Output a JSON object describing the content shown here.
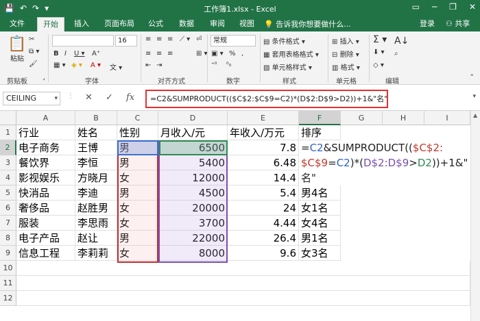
{
  "window": {
    "title": "工作簿1.xlsx - Excel",
    "qat": [
      "💾",
      "↶",
      "↷",
      "▾"
    ],
    "controls": [
      "▭",
      "─",
      "❐",
      "✕"
    ]
  },
  "tabs": [
    "文件",
    "开始",
    "插入",
    "页面布局",
    "公式",
    "数据",
    "审阅",
    "视图"
  ],
  "active_tab": "开始",
  "tellme": "告诉我你想要做什么...",
  "account": {
    "login": "登录",
    "share": "共享"
  },
  "ribbon": {
    "groups": [
      "剪贴板",
      "字体",
      "对齐方式",
      "数字",
      "样式",
      "单元格",
      "编辑"
    ],
    "paste": "粘贴",
    "font_size": "16",
    "number_format": "常规",
    "styles": [
      "条件格式 ▾",
      "套用表格格式 ▾",
      "单元格样式 ▾"
    ],
    "cells": [
      "插入 ▾",
      "删除 ▾",
      "格式 ▾"
    ]
  },
  "formula_bar": {
    "name_box": "CEILING",
    "formula": "=C2&SUMPRODUCT(($C$2:$C$9=C2)*(D$2:D$9>D2))+1&\"名\""
  },
  "columns": [
    "A",
    "B",
    "C",
    "D",
    "E",
    "F",
    "G",
    "H",
    "I"
  ],
  "rows": [
    "1",
    "2",
    "3",
    "4",
    "5",
    "6",
    "7",
    "8",
    "9",
    "10",
    "11",
    "12"
  ],
  "header_row": [
    "行业",
    "姓名",
    "性别",
    "月收入/元",
    "年收入/万元",
    "排序"
  ],
  "data_rows": [
    [
      "电子商务",
      "王博",
      "男",
      "6500",
      "7.8",
      ""
    ],
    [
      "餐饮界",
      "李恒",
      "男",
      "5400",
      "6.48",
      ""
    ],
    [
      "影视娱乐",
      "方晓月",
      "女",
      "12000",
      "14.4",
      ""
    ],
    [
      "快消品",
      "李迪",
      "男",
      "4500",
      "5.4",
      "男4名"
    ],
    [
      "奢侈品",
      "赵胜男",
      "女",
      "20000",
      "24",
      "女1名"
    ],
    [
      "服装",
      "李思雨",
      "女",
      "3700",
      "4.44",
      "女4名"
    ],
    [
      "电子产品",
      "赵让",
      "男",
      "22000",
      "26.4",
      "男1名"
    ],
    [
      "信息工程",
      "李莉莉",
      "女",
      "8000",
      "9.6",
      "女3名"
    ]
  ],
  "edit_text": {
    "line1": [
      "=",
      "C2",
      "&SUMPRODUCT((",
      "$C$2:"
    ],
    "line2": [
      "$C$9",
      "=",
      "C2",
      ")*(",
      "D$2:D$9",
      ">",
      "D2",
      "))+1&\""
    ],
    "line3": "名\""
  }
}
